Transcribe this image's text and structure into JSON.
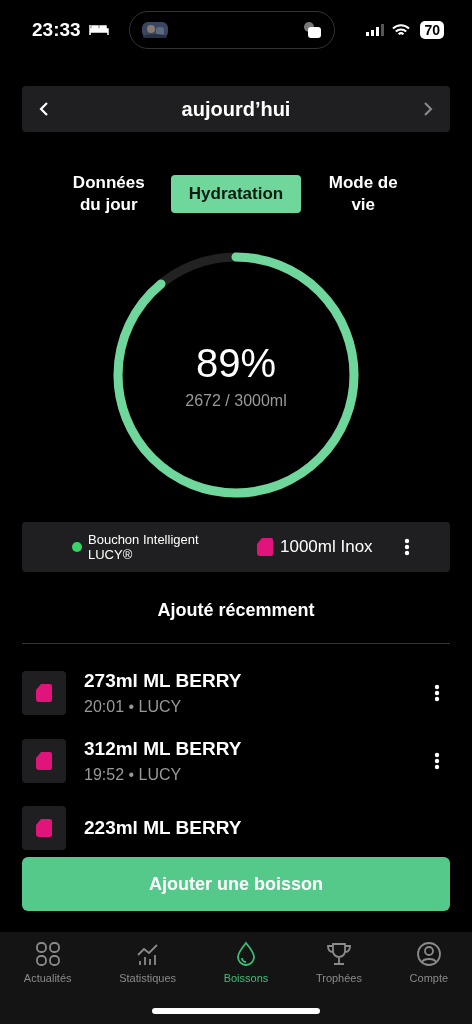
{
  "status_bar": {
    "time": "23:33",
    "battery": "70"
  },
  "date_nav": {
    "label": "aujourd’hui"
  },
  "tabs": [
    {
      "label": "Données du jour",
      "selected": false
    },
    {
      "label": "Hydratation",
      "selected": true
    },
    {
      "label": "Mode de vie",
      "selected": false
    }
  ],
  "progress": {
    "percent": "89%",
    "amount": "2672 / 3000ml"
  },
  "device": {
    "name": "Bouchon Intelligent LUCY®",
    "connected": true,
    "bottle": "1000ml Inox"
  },
  "recent": {
    "title": "Ajouté récemment",
    "items": [
      {
        "title": "273ml ML BERRY",
        "meta": "20:01 • LUCY"
      },
      {
        "title": "312ml ML BERRY",
        "meta": "19:52 • LUCY"
      },
      {
        "title": "223ml ML BERRY"
      }
    ]
  },
  "add_button": "Ajouter une boisson",
  "nav": [
    {
      "label": "Actualités",
      "kind": "news",
      "selected": false
    },
    {
      "label": "Statistiques",
      "kind": "stats",
      "selected": false
    },
    {
      "label": "Boissons",
      "kind": "drop",
      "selected": true
    },
    {
      "label": "Trophées",
      "kind": "trophy",
      "selected": false
    },
    {
      "label": "Compte",
      "kind": "account",
      "selected": false
    }
  ]
}
